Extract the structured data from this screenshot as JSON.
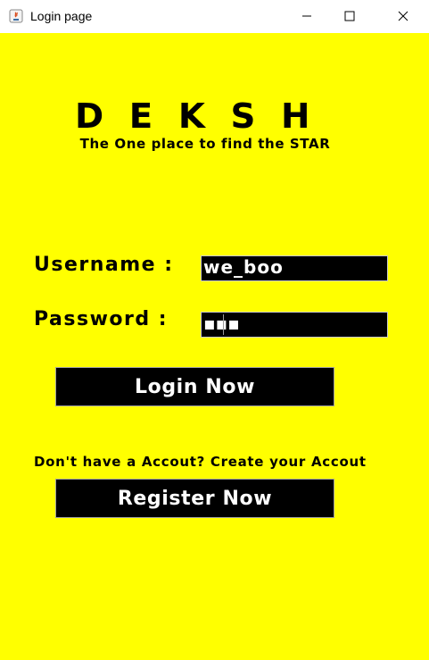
{
  "window": {
    "title": "Login page",
    "icons": [
      "java-app-icon",
      "minimize-icon",
      "maximize-icon",
      "close-icon"
    ]
  },
  "logo": {
    "text": "DEKSH",
    "tagline": "The One place to find the STAR"
  },
  "form": {
    "username_label": "Username :",
    "username_value": "we_boo",
    "password_label": "Password :",
    "password_value": "▪▪▪",
    "login_button": "Login Now"
  },
  "register": {
    "prompt": "Don't have a Accout? Create your Accout",
    "button": "Register Now"
  },
  "colors": {
    "background": "#ffff00",
    "field_bg": "#000000",
    "button_bg": "#000000",
    "text": "#000000",
    "button_text": "#ffffff"
  }
}
